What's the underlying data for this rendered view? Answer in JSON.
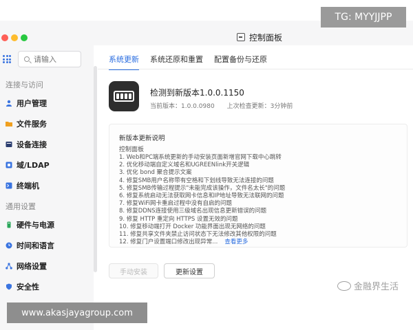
{
  "watermarks": {
    "top_right": "TG: MYYJJPP",
    "bottom_right": "金融界生活",
    "bottom_left": "www.akasjayagroup.com"
  },
  "window": {
    "title": "控制面板"
  },
  "sidebar": {
    "search_placeholder": "请输入",
    "groups": [
      {
        "label": "连接与访问",
        "items": [
          {
            "label": "用户管理",
            "icon": "user-icon",
            "color": "#3a74e0"
          },
          {
            "label": "文件服务",
            "icon": "folder-icon",
            "color": "#f0a020"
          },
          {
            "label": "设备连接",
            "icon": "device-icon",
            "color": "#2c3e70"
          },
          {
            "label": "域/LDAP",
            "icon": "domain-icon",
            "color": "#3a74e0"
          },
          {
            "label": "终端机",
            "icon": "terminal-icon",
            "color": "#3a74e0"
          }
        ]
      },
      {
        "label": "通用设置",
        "items": [
          {
            "label": "硬件与电源",
            "icon": "hardware-icon",
            "color": "#2aa65a"
          },
          {
            "label": "时间和语言",
            "icon": "clock-icon",
            "color": "#3a74e0"
          },
          {
            "label": "网络设置",
            "icon": "network-icon",
            "color": "#3a74e0"
          },
          {
            "label": "安全性",
            "icon": "shield-icon",
            "color": "#3a74e0"
          }
        ]
      }
    ]
  },
  "tabs": [
    {
      "label": "系统更新",
      "active": true
    },
    {
      "label": "系统还原和重置",
      "active": false
    },
    {
      "label": "配置备份与还原",
      "active": false
    }
  ],
  "update": {
    "title": "检测到新版本1.0.0.1150",
    "current_version": "当前版本：1.0.0.0980",
    "last_check": "上次检查更新：3分钟前"
  },
  "notes": {
    "title": "新版本更新说明",
    "subtitle": "控制面板",
    "items": [
      "1. Web和PC端系统更新的手动安装页面新增官网下载中心跳转",
      "2. 优化移动端自定义域名和UGREENlink开关逻辑",
      "3. 优化 bond 聚合提示文案",
      "4. 修复SMB用户名称带有空格和下划线导致无法连接的问题",
      "5. 修复SMB传输过程提示\"未能完成该操作，文件名太长\"的问题",
      "6. 修复系统启动无法获取网卡信息和IP地址导致无法联网的问题",
      "7. 修复WiFi网卡重启过程中没有自启的问题",
      "8. 修复DDNS连接使用三级域名出现信息更新错误的问题",
      "9. 修复 HTTP 重定向 HTTPS 设置无效的问题",
      "10. 修复移动端打开 Docker 功能界面出现无网络的问题",
      "11. 修复共享文件夹禁止访问状态下无法修改其他权限的问题",
      "12. 修复门户设置端口修改出现异常..."
    ],
    "see_more": "查看更多"
  },
  "buttons": {
    "manual_install": "手动安装",
    "update_settings": "更新设置"
  }
}
